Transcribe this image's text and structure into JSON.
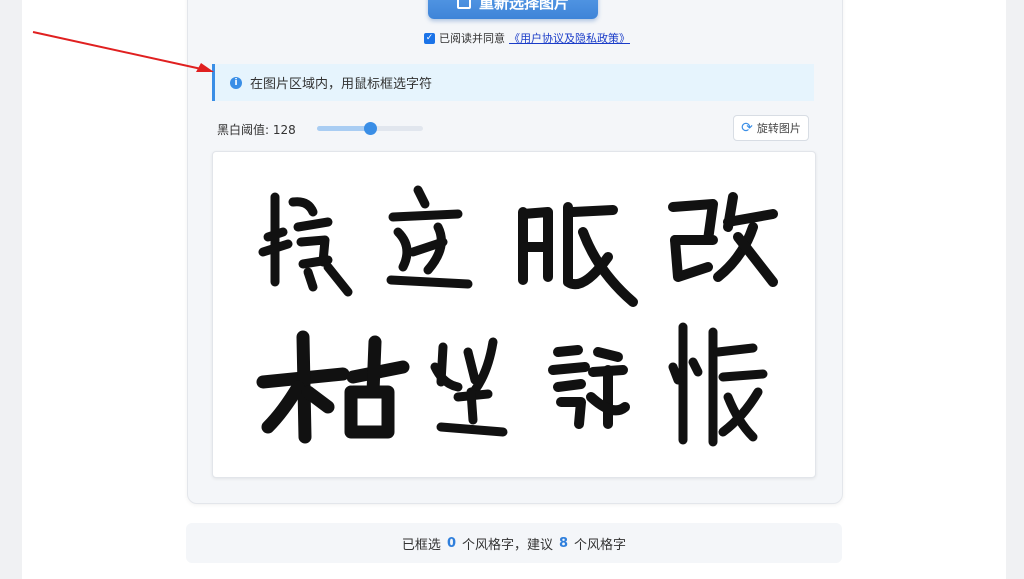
{
  "toolbar": {
    "reselect_label": "重新选择图片"
  },
  "agreement": {
    "prefix": "已阅读并同意",
    "link": "《用户协议及隐私政策》",
    "checked": true
  },
  "tip": {
    "text": "在图片区域内，用鼠标框选字符"
  },
  "threshold": {
    "label": "黑白阈值: 128",
    "value": 128,
    "max": 255
  },
  "rotate": {
    "label": "旋转图片"
  },
  "count": {
    "prefix": "已框选",
    "selected": "0",
    "middle": "个风格字，建议",
    "suggested": "8",
    "suffix": "个风格字"
  },
  "colors": {
    "accent": "#3a8ee6",
    "ink": "#111111",
    "annotation_arrow": "#e02020"
  }
}
